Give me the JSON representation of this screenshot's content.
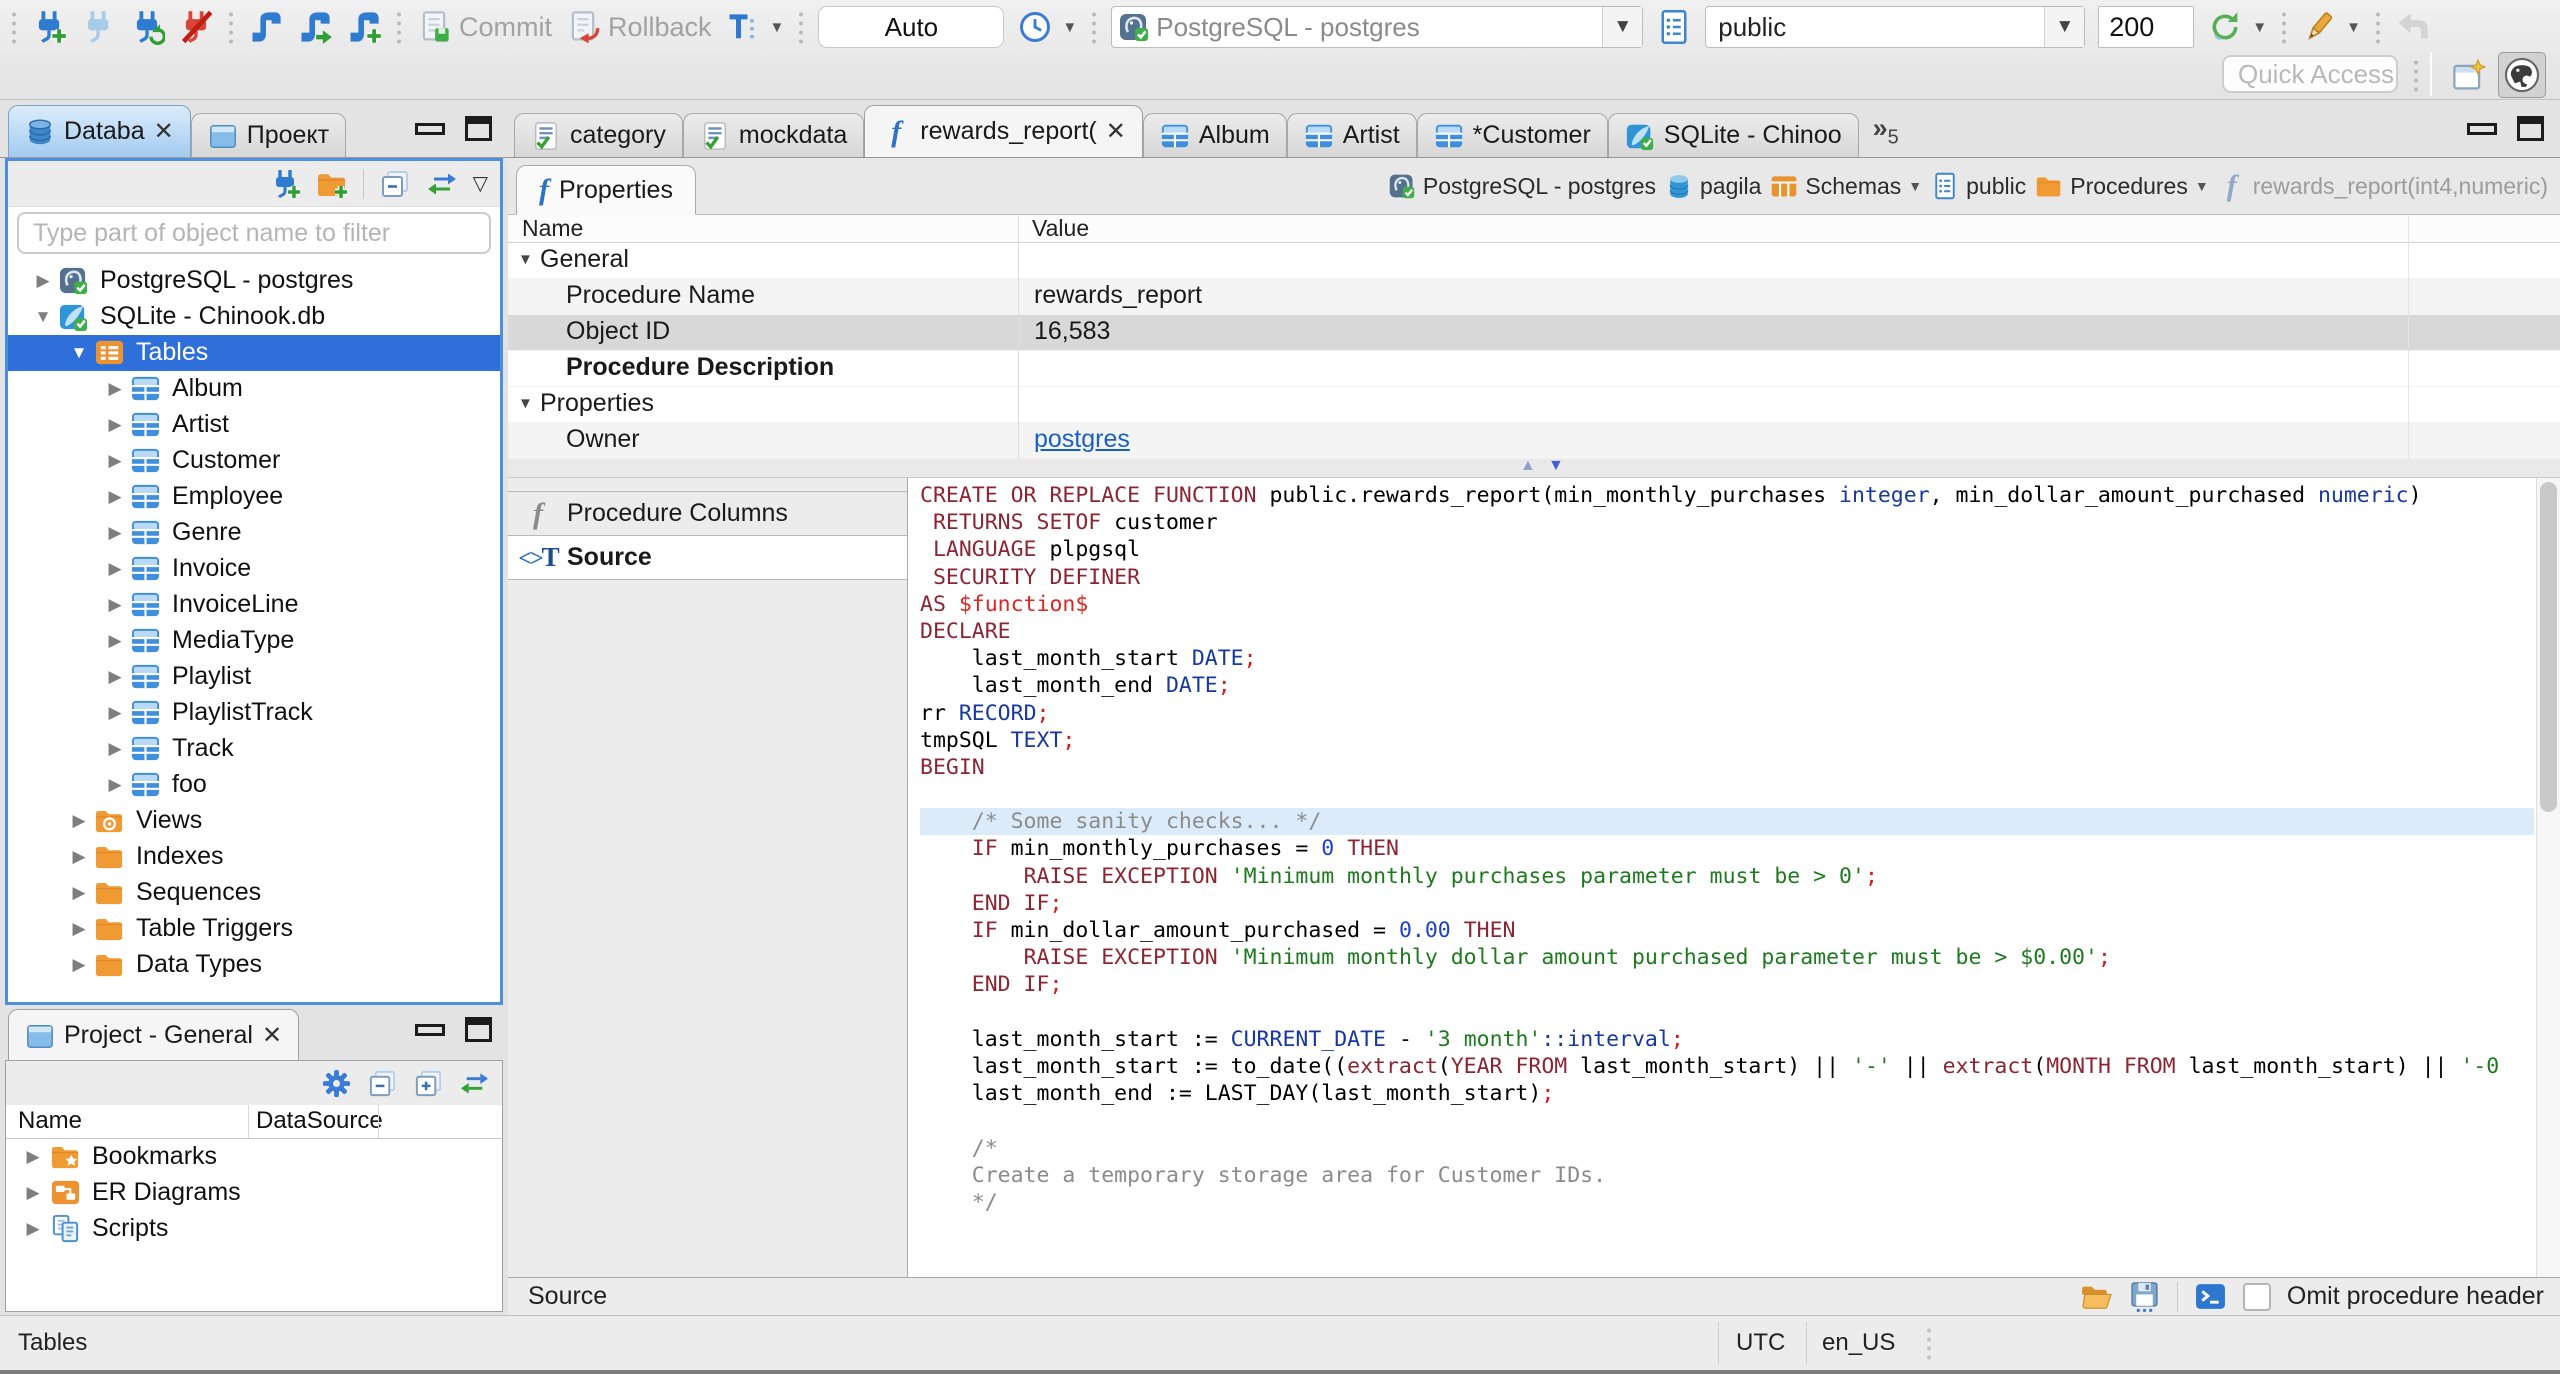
{
  "toolbar": {
    "commit_label": "Commit",
    "rollback_label": "Rollback",
    "auto_label": "Auto",
    "connection_value": "PostgreSQL - postgres",
    "schema_value": "public",
    "fetch_size": "200",
    "quick_access_placeholder": "Quick Access"
  },
  "left_tabs": {
    "database": "Databa",
    "project": "Проект"
  },
  "navigator": {
    "filter_placeholder": "Type part of object name to filter",
    "tree": [
      {
        "depth": 0,
        "arrow": "collapsed",
        "icon": "postgresql",
        "label": "PostgreSQL - postgres"
      },
      {
        "depth": 0,
        "arrow": "expanded",
        "icon": "sqlite",
        "label": "SQLite - Chinook.db"
      },
      {
        "depth": 1,
        "arrow": "expanded",
        "icon": "tables-folder",
        "label": "Tables",
        "selected": true
      },
      {
        "depth": 2,
        "arrow": "collapsed",
        "icon": "table",
        "label": "Album"
      },
      {
        "depth": 2,
        "arrow": "collapsed",
        "icon": "table",
        "label": "Artist"
      },
      {
        "depth": 2,
        "arrow": "collapsed",
        "icon": "table",
        "label": "Customer"
      },
      {
        "depth": 2,
        "arrow": "collapsed",
        "icon": "table",
        "label": "Employee"
      },
      {
        "depth": 2,
        "arrow": "collapsed",
        "icon": "table",
        "label": "Genre"
      },
      {
        "depth": 2,
        "arrow": "collapsed",
        "icon": "table",
        "label": "Invoice"
      },
      {
        "depth": 2,
        "arrow": "collapsed",
        "icon": "table",
        "label": "InvoiceLine"
      },
      {
        "depth": 2,
        "arrow": "collapsed",
        "icon": "table",
        "label": "MediaType"
      },
      {
        "depth": 2,
        "arrow": "collapsed",
        "icon": "table",
        "label": "Playlist"
      },
      {
        "depth": 2,
        "arrow": "collapsed",
        "icon": "table",
        "label": "PlaylistTrack"
      },
      {
        "depth": 2,
        "arrow": "collapsed",
        "icon": "table",
        "label": "Track"
      },
      {
        "depth": 2,
        "arrow": "collapsed",
        "icon": "table",
        "label": "foo"
      },
      {
        "depth": 1,
        "arrow": "collapsed",
        "icon": "views-folder",
        "label": "Views"
      },
      {
        "depth": 1,
        "arrow": "collapsed",
        "icon": "folder",
        "label": "Indexes"
      },
      {
        "depth": 1,
        "arrow": "collapsed",
        "icon": "folder",
        "label": "Sequences"
      },
      {
        "depth": 1,
        "arrow": "collapsed",
        "icon": "folder",
        "label": "Table Triggers"
      },
      {
        "depth": 1,
        "arrow": "collapsed",
        "icon": "folder",
        "label": "Data Types"
      }
    ]
  },
  "project_panel": {
    "title": "Project - General",
    "columns": {
      "name": "Name",
      "datasource": "DataSource"
    },
    "items": [
      {
        "icon": "folder-star",
        "label": "Bookmarks"
      },
      {
        "icon": "er",
        "label": "ER Diagrams"
      },
      {
        "icon": "scripts",
        "label": "Scripts"
      }
    ]
  },
  "editor": {
    "tabs": [
      {
        "icon": "script-check",
        "label": "category"
      },
      {
        "icon": "script-check",
        "label": "mockdata"
      },
      {
        "icon": "function",
        "label": "rewards_report(",
        "active": true,
        "closable": true
      },
      {
        "icon": "table",
        "label": "Album"
      },
      {
        "icon": "table",
        "label": "Artist"
      },
      {
        "icon": "table",
        "label": "*Customer"
      },
      {
        "icon": "sqlite",
        "label": "SQLite - Chinoo"
      }
    ],
    "overflow_count": "5",
    "properties_tab": "Properties"
  },
  "breadcrumb": [
    {
      "icon": "postgresql",
      "label": "PostgreSQL - postgres"
    },
    {
      "icon": "db",
      "label": "pagila"
    },
    {
      "icon": "schemas",
      "label": "Schemas",
      "dropdown": true
    },
    {
      "icon": "page",
      "label": "public"
    },
    {
      "icon": "folder",
      "label": "Procedures",
      "dropdown": true
    },
    {
      "icon": "function-muted",
      "label": "rewards_report(int4,numeric)",
      "muted": true
    }
  ],
  "properties_grid": {
    "columns": {
      "name": "Name",
      "value": "Value"
    },
    "rows": [
      {
        "kind": "group",
        "name": "General"
      },
      {
        "kind": "prop",
        "name": "Procedure Name",
        "value": "rewards_report",
        "shaded": true
      },
      {
        "kind": "prop",
        "name": "Object ID",
        "value": "16,583",
        "selected": true
      },
      {
        "kind": "prop",
        "name": "Procedure Description",
        "value": "",
        "bold": true
      },
      {
        "kind": "group",
        "name": "Properties"
      },
      {
        "kind": "prop",
        "name": "Owner",
        "value": "postgres",
        "link": true,
        "shaded": true
      }
    ]
  },
  "subtabs": [
    {
      "icon": "function-gray",
      "label": "Procedure Columns"
    },
    {
      "icon": "source",
      "label": "Source",
      "active": true
    }
  ],
  "source": {
    "footer_label": "Source",
    "omit_checkbox_label": "Omit procedure header",
    "lines": [
      {
        "segments": [
          [
            "kw",
            "CREATE OR REPLACE FUNCTION"
          ],
          [
            "pl",
            " public.rewards_report(min_monthly_purchases "
          ],
          [
            "ty",
            "integer"
          ],
          [
            "pl",
            ", min_dollar_amount_purchased "
          ],
          [
            "ty",
            "numeric"
          ],
          [
            "pl",
            ")"
          ]
        ]
      },
      {
        "segments": [
          [
            "pl",
            " "
          ],
          [
            "kw",
            "RETURNS SETOF"
          ],
          [
            "pl",
            " customer"
          ]
        ]
      },
      {
        "segments": [
          [
            "pl",
            " "
          ],
          [
            "kw",
            "LANGUAGE"
          ],
          [
            "pl",
            " plpgsql"
          ]
        ]
      },
      {
        "segments": [
          [
            "pl",
            " "
          ],
          [
            "kw",
            "SECURITY DEFINER"
          ]
        ]
      },
      {
        "segments": [
          [
            "kw",
            "AS"
          ],
          [
            "pl",
            " "
          ],
          [
            "dl",
            "$function$"
          ]
        ]
      },
      {
        "segments": [
          [
            "kw",
            "DECLARE"
          ]
        ]
      },
      {
        "segments": [
          [
            "pl",
            "    last_month_start "
          ],
          [
            "ty",
            "DATE"
          ],
          [
            "pu",
            ";"
          ]
        ]
      },
      {
        "segments": [
          [
            "pl",
            "    last_month_end "
          ],
          [
            "ty",
            "DATE"
          ],
          [
            "pu",
            ";"
          ]
        ]
      },
      {
        "segments": [
          [
            "pl",
            "rr "
          ],
          [
            "ty",
            "RECORD"
          ],
          [
            "pu",
            ";"
          ]
        ]
      },
      {
        "segments": [
          [
            "pl",
            "tmpSQL "
          ],
          [
            "ty",
            "TEXT"
          ],
          [
            "pu",
            ";"
          ]
        ]
      },
      {
        "segments": [
          [
            "kw",
            "BEGIN"
          ]
        ]
      },
      {
        "segments": []
      },
      {
        "highlight": true,
        "segments": [
          [
            "cm",
            "    /* Some sanity checks... */"
          ]
        ]
      },
      {
        "segments": [
          [
            "pl",
            "    "
          ],
          [
            "kw",
            "IF"
          ],
          [
            "pl",
            " min_monthly_purchases = "
          ],
          [
            "nu",
            "0"
          ],
          [
            "pl",
            " "
          ],
          [
            "kw",
            "THEN"
          ]
        ]
      },
      {
        "segments": [
          [
            "pl",
            "        "
          ],
          [
            "kw",
            "RAISE EXCEPTION"
          ],
          [
            "pl",
            " "
          ],
          [
            "st",
            "'Minimum monthly purchases parameter must be > 0'"
          ],
          [
            "pu",
            ";"
          ]
        ]
      },
      {
        "segments": [
          [
            "pl",
            "    "
          ],
          [
            "kw",
            "END IF"
          ],
          [
            "pu",
            ";"
          ]
        ]
      },
      {
        "segments": [
          [
            "pl",
            "    "
          ],
          [
            "kw",
            "IF"
          ],
          [
            "pl",
            " min_dollar_amount_purchased = "
          ],
          [
            "nu",
            "0.00"
          ],
          [
            "pl",
            " "
          ],
          [
            "kw",
            "THEN"
          ]
        ]
      },
      {
        "segments": [
          [
            "pl",
            "        "
          ],
          [
            "kw",
            "RAISE EXCEPTION"
          ],
          [
            "pl",
            " "
          ],
          [
            "st",
            "'Minimum monthly dollar amount purchased parameter must be > $0.00'"
          ],
          [
            "pu",
            ";"
          ]
        ]
      },
      {
        "segments": [
          [
            "pl",
            "    "
          ],
          [
            "kw",
            "END IF"
          ],
          [
            "pu",
            ";"
          ]
        ]
      },
      {
        "segments": []
      },
      {
        "segments": [
          [
            "pl",
            "    last_month_start := "
          ],
          [
            "ty",
            "CURRENT_DATE"
          ],
          [
            "pl",
            " - "
          ],
          [
            "st",
            "'3 month'"
          ],
          [
            "ty",
            "::interval"
          ],
          [
            "pu",
            ";"
          ]
        ]
      },
      {
        "segments": [
          [
            "pl",
            "    last_month_start := to_date(("
          ],
          [
            "kw",
            "extract"
          ],
          [
            "pl",
            "("
          ],
          [
            "kw",
            "YEAR FROM"
          ],
          [
            "pl",
            " last_month_start) || "
          ],
          [
            "st",
            "'-'"
          ],
          [
            "pl",
            " || "
          ],
          [
            "kw",
            "extract"
          ],
          [
            "pl",
            "("
          ],
          [
            "kw",
            "MONTH FROM"
          ],
          [
            "pl",
            " last_month_start) || "
          ],
          [
            "st",
            "'-0"
          ]
        ]
      },
      {
        "segments": [
          [
            "pl",
            "    last_month_end := LAST_DAY(last_month_start)"
          ],
          [
            "pu",
            ";"
          ]
        ]
      },
      {
        "segments": []
      },
      {
        "segments": [
          [
            "cm",
            "    /*"
          ]
        ]
      },
      {
        "segments": [
          [
            "cm",
            "    Create a temporary storage area for Customer IDs."
          ]
        ]
      },
      {
        "segments": [
          [
            "cm",
            "    */"
          ]
        ]
      }
    ]
  },
  "statusbar": {
    "left": "Tables",
    "timezone": "UTC",
    "locale": "en_US"
  }
}
